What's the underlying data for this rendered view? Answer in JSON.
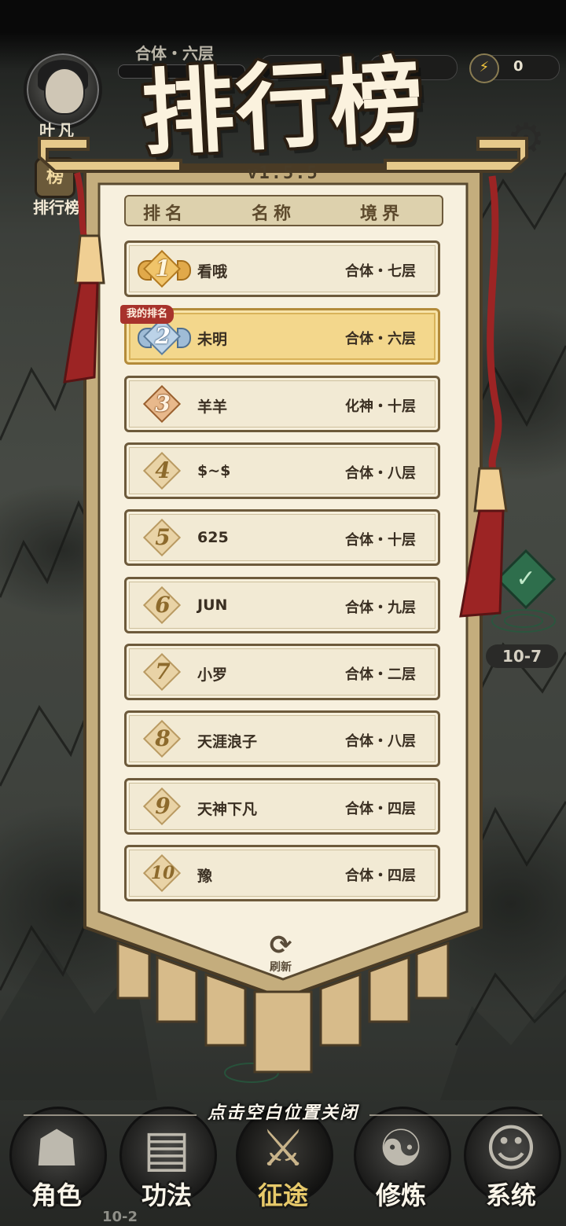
{
  "hud": {
    "player_name": "叶凡",
    "player_level": "合体・六层",
    "energy_value": "0",
    "energy_icon": "lightning-icon",
    "settings_icon": "gear-icon",
    "side_button_label": "排行榜",
    "side_button_glyph": "榜"
  },
  "map": {
    "stage_label": "10-7",
    "stage_label_bottom": "10-2",
    "check_glyph": "✓"
  },
  "leaderboard": {
    "title": "排行榜",
    "version": "v1.5.5",
    "header": {
      "rank": "排名",
      "name": "名称",
      "realm": "境界"
    },
    "my_rank_tag": "我的排名",
    "rows": [
      {
        "rank": "1",
        "name": "看哦",
        "realm": "合体・七层"
      },
      {
        "rank": "2",
        "name": "未明",
        "realm": "合体・六层"
      },
      {
        "rank": "3",
        "name": "羊羊",
        "realm": "化神・十层"
      },
      {
        "rank": "4",
        "name": "$~$",
        "realm": "合体・八层"
      },
      {
        "rank": "5",
        "name": "625",
        "realm": "合体・十层"
      },
      {
        "rank": "6",
        "name": "JUN",
        "realm": "合体・九层"
      },
      {
        "rank": "7",
        "name": "小罗",
        "realm": "合体・二层"
      },
      {
        "rank": "8",
        "name": "天涯浪子",
        "realm": "合体・八层"
      },
      {
        "rank": "9",
        "name": "天神下凡",
        "realm": "合体・四层"
      },
      {
        "rank": "10",
        "name": "豫",
        "realm": "合体・四层"
      }
    ],
    "refresh_label": "刷新",
    "refresh_icon": "refresh-icon",
    "close_hint": "点击空白位置关闭"
  },
  "nav": {
    "items": [
      {
        "label": "角色",
        "icon": "character-icon"
      },
      {
        "label": "功法",
        "icon": "skills-book-icon"
      },
      {
        "label": "征途",
        "icon": "sword-icon"
      },
      {
        "label": "修炼",
        "icon": "meditation-icon"
      },
      {
        "label": "系统",
        "icon": "system-icon"
      }
    ],
    "active": "征途"
  },
  "colors": {
    "panel_bg": "#f2ead4",
    "panel_border": "#6d5a3b",
    "highlight_row": "#f3d78c",
    "tassel_red": "#9c2424",
    "my_rank_tag": "#a8332c"
  }
}
